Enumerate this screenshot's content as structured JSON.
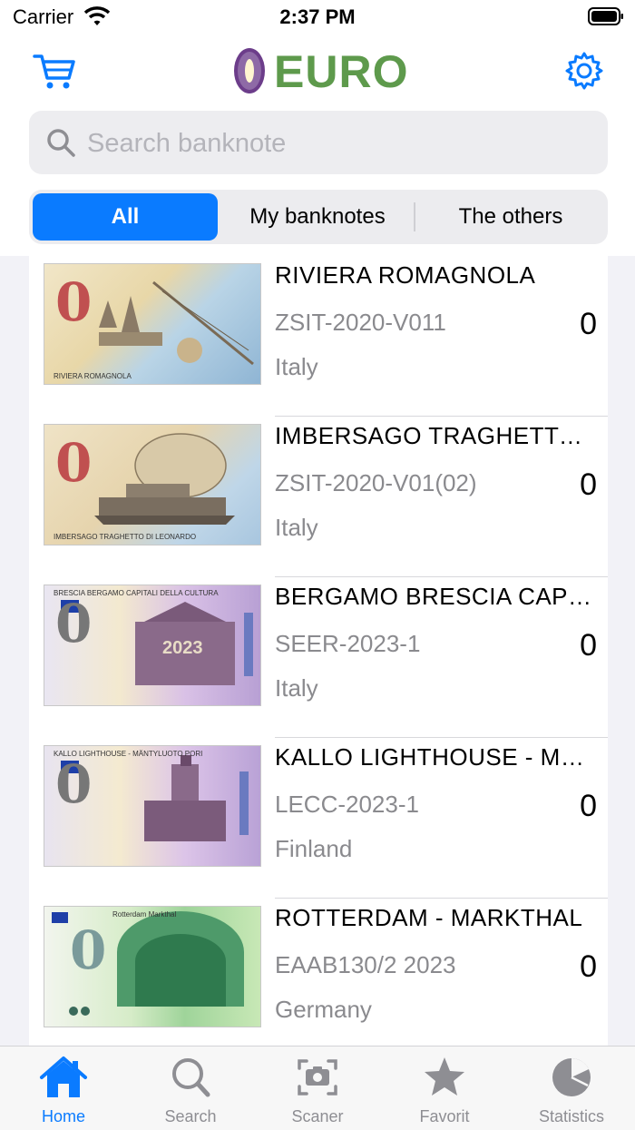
{
  "status_bar": {
    "carrier": "Carrier",
    "time": "2:37 PM"
  },
  "header": {
    "logo_text": "EURO",
    "cart_icon": "cart-icon",
    "settings_icon": "gear-icon"
  },
  "search": {
    "placeholder": "Search banknote",
    "value": ""
  },
  "segments": [
    {
      "label": "All",
      "selected": true
    },
    {
      "label": "My banknotes",
      "selected": false
    },
    {
      "label": "The others",
      "selected": false
    }
  ],
  "banknotes": [
    {
      "name": "RIVIERA ROMAGNOLA",
      "code": "ZSIT-2020-V011",
      "country": "Italy",
      "count": "0",
      "note_caption": "RIVIERA ROMAGNOLA"
    },
    {
      "name": "IMBERSAGO TRAGHETTO…",
      "code": "ZSIT-2020-V01(02)",
      "country": "Italy",
      "count": "0",
      "note_caption": "IMBERSAGO TRAGHETTO DI LEONARDO"
    },
    {
      "name": "BERGAMO BRESCIA CAPI…",
      "code": "SEER-2023-1",
      "country": "Italy",
      "count": "0",
      "note_caption": "BRESCIA BERGAMO CAPITALI DELLA CULTURA"
    },
    {
      "name": "KALLO LIGHTHOUSE - M…",
      "code": "LECC-2023-1",
      "country": "Finland",
      "count": "0",
      "note_caption": "KALLO LIGHTHOUSE - MÄNTYLUOTO PORI"
    },
    {
      "name": "ROTTERDAM - MARKTHAL",
      "code": "EAAB130/2 2023",
      "country": "Germany",
      "count": "0",
      "note_caption": "Rotterdam Markthal"
    }
  ],
  "tabs": [
    {
      "label": "Home",
      "icon": "home-icon",
      "active": true
    },
    {
      "label": "Search",
      "icon": "search-icon",
      "active": false
    },
    {
      "label": "Scaner",
      "icon": "camera-scan-icon",
      "active": false
    },
    {
      "label": "Favorit",
      "icon": "star-icon",
      "active": false
    },
    {
      "label": "Statistics",
      "icon": "pie-chart-icon",
      "active": false
    }
  ],
  "colors": {
    "accent": "#0a7bff",
    "logo_green": "#5e9a4c",
    "logo_purple": "#6c3d8a",
    "secondary_text": "#8a8a8e"
  }
}
